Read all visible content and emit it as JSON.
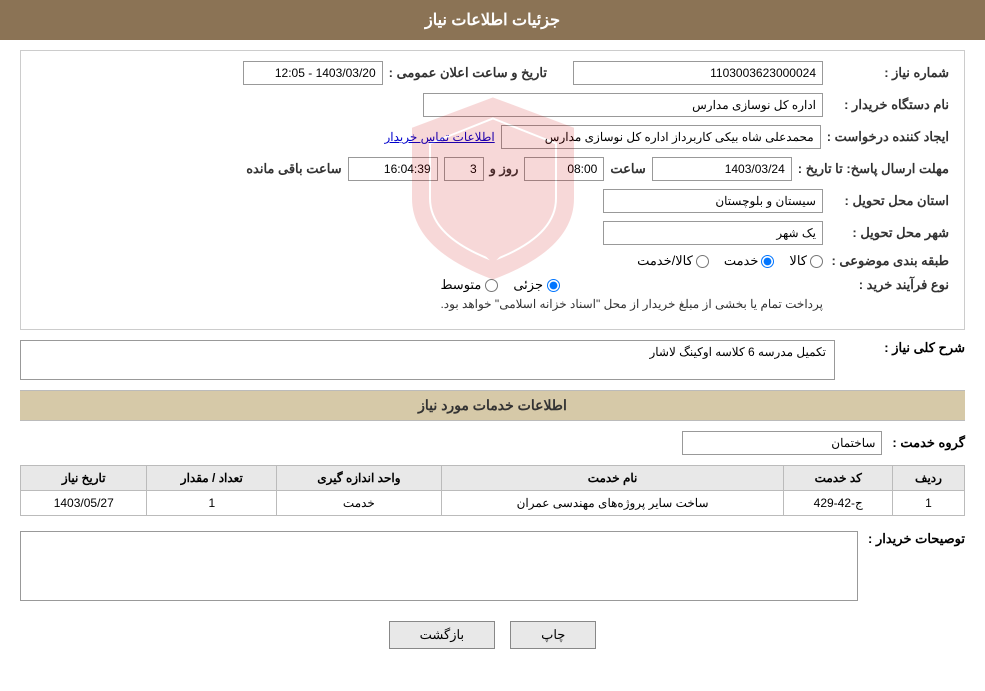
{
  "header": {
    "title": "جزئیات اطلاعات نیاز"
  },
  "fields": {
    "shomara_niaz_label": "شماره نیاز :",
    "shomara_niaz_value": "1103003623000024",
    "name_dastgah_label": "نام دستگاه خریدار :",
    "name_dastgah_value": "اداره کل نوسازی مدارس",
    "ijad_konande_label": "ایجاد کننده درخواست :",
    "ijad_konande_value": "محمدعلی شاه بیکی کاربرداز اداره کل نوسازی مدارس",
    "contact_link": "اطلاعات تماس خریدار",
    "mohlet_ersal_label": "مهلت ارسال پاسخ: تا تاریخ :",
    "mohlet_date": "1403/03/24",
    "mohlet_time_label": "ساعت",
    "mohlet_time": "08:00",
    "mohlet_rooz_label": "روز و",
    "mohlet_days": "3",
    "mohlet_remaining_label": "ساعت باقی مانده",
    "mohlet_remaining": "16:04:39",
    "ostan_label": "استان محل تحویل :",
    "ostan_value": "سیستان و بلوچستان",
    "shahr_label": "شهر محل تحویل :",
    "shahr_value": "یک شهر",
    "tabaqe_label": "طبقه بندی موضوعی :",
    "tabaqe_kala": "کالا",
    "tabaqe_khedmat": "خدمت",
    "tabaqe_kala_khedmat": "کالا/خدمت",
    "tarikh_ilan_label": "تاریخ و ساعت اعلان عمومی :",
    "tarikh_ilan_value": "1403/03/20 - 12:05",
    "nooe_farayand_label": "نوع فرآیند خرید :",
    "nooe_jozii": "جزئی",
    "nooe_motovaset": "متوسط",
    "nooe_note": "پرداخت تمام یا بخشی از مبلغ خریدار از محل \"اسناد خزانه اسلامی\" خواهد بود.",
    "sharh_koli_label": "شرح کلی نیاز :",
    "sharh_koli_value": "تکمیل مدرسه 6 کلاسه اوکینگ لاشار",
    "khedamat_label": "اطلاعات خدمات مورد نیاز",
    "gorohe_khedmat_label": "گروه خدمت :",
    "gorohe_khedmat_value": "ساختمان",
    "table": {
      "headers": [
        "ردیف",
        "کد خدمت",
        "نام خدمت",
        "واحد اندازه گیری",
        "تعداد / مقدار",
        "تاریخ نیاز"
      ],
      "rows": [
        {
          "radif": "1",
          "kod_khedmat": "ج-42-429",
          "naam_khedmat": "ساخت سایر پروژه‌های مهندسی عمران",
          "vahed": "خدمت",
          "tedad": "1",
          "tarikh": "1403/05/27"
        }
      ]
    },
    "buyer_notes_label": "توصیحات خریدار :",
    "buyer_notes_value": ""
  },
  "buttons": {
    "print": "چاپ",
    "back": "بازگشت"
  }
}
